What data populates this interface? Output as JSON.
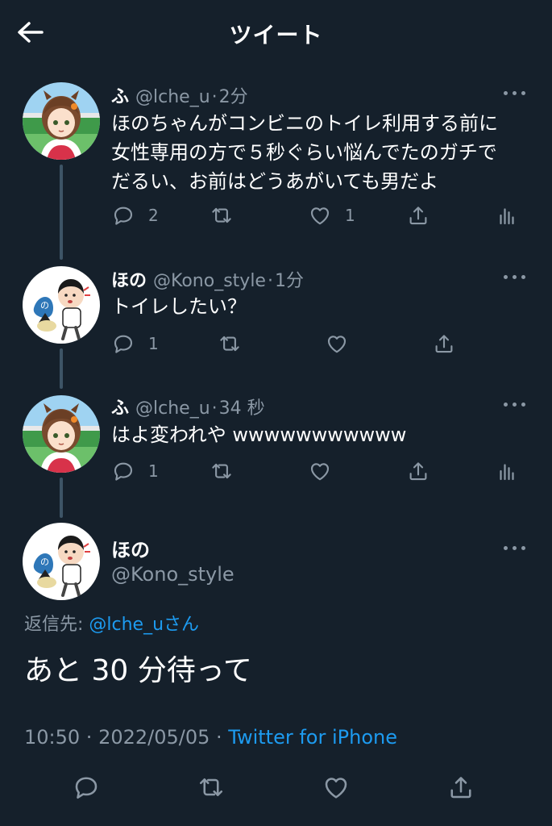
{
  "header": {
    "title": "ツイート"
  },
  "colors": {
    "background": "#15202b",
    "secondary_text": "#8b98a5",
    "link": "#1d9bf0",
    "thread_line": "#3d5466"
  },
  "thread": [
    {
      "name": "ふ",
      "handle": "@lche_u",
      "separator": "·",
      "time": "2分",
      "text": [
        "ほのちゃんがコンビニのトイレ利用する前に",
        "女性専用の方で５秒ぐらい悩んでたのガチで",
        "だるい、お前はどうあがいても男だよ"
      ],
      "replies": "2",
      "retweets": "",
      "likes": "1",
      "avatar_icon": "anime-girl-avatar"
    },
    {
      "name": "ほの",
      "handle": "@Kono_style",
      "separator": "·",
      "time": "1分",
      "text": [
        "トイレしたい？"
      ],
      "replies": "1",
      "retweets": "",
      "likes": "",
      "avatar_icon": "cartoon-boy-avatar"
    },
    {
      "name": "ふ",
      "handle": "@lche_u",
      "separator": "·",
      "time": "34 秒",
      "text": [
        "はよ変われや wwwwwwwwwww"
      ],
      "replies": "1",
      "retweets": "",
      "likes": "",
      "avatar_icon": "anime-girl-avatar"
    }
  ],
  "main_tweet": {
    "name": "ほの",
    "handle": "@Kono_style",
    "reply_prefix": "返信先: ",
    "reply_handle": "@lche_u",
    "reply_suffix": "さん",
    "text": "あと 30 分待って",
    "time": "10:50",
    "separator": " · ",
    "date": "2022/05/05",
    "client": "Twitter for iPhone",
    "avatar_icon": "cartoon-boy-avatar"
  },
  "icons": [
    "back-arrow-icon",
    "more-dots-icon",
    "reply-icon",
    "retweet-icon",
    "like-icon",
    "share-icon",
    "analytics-icon"
  ]
}
